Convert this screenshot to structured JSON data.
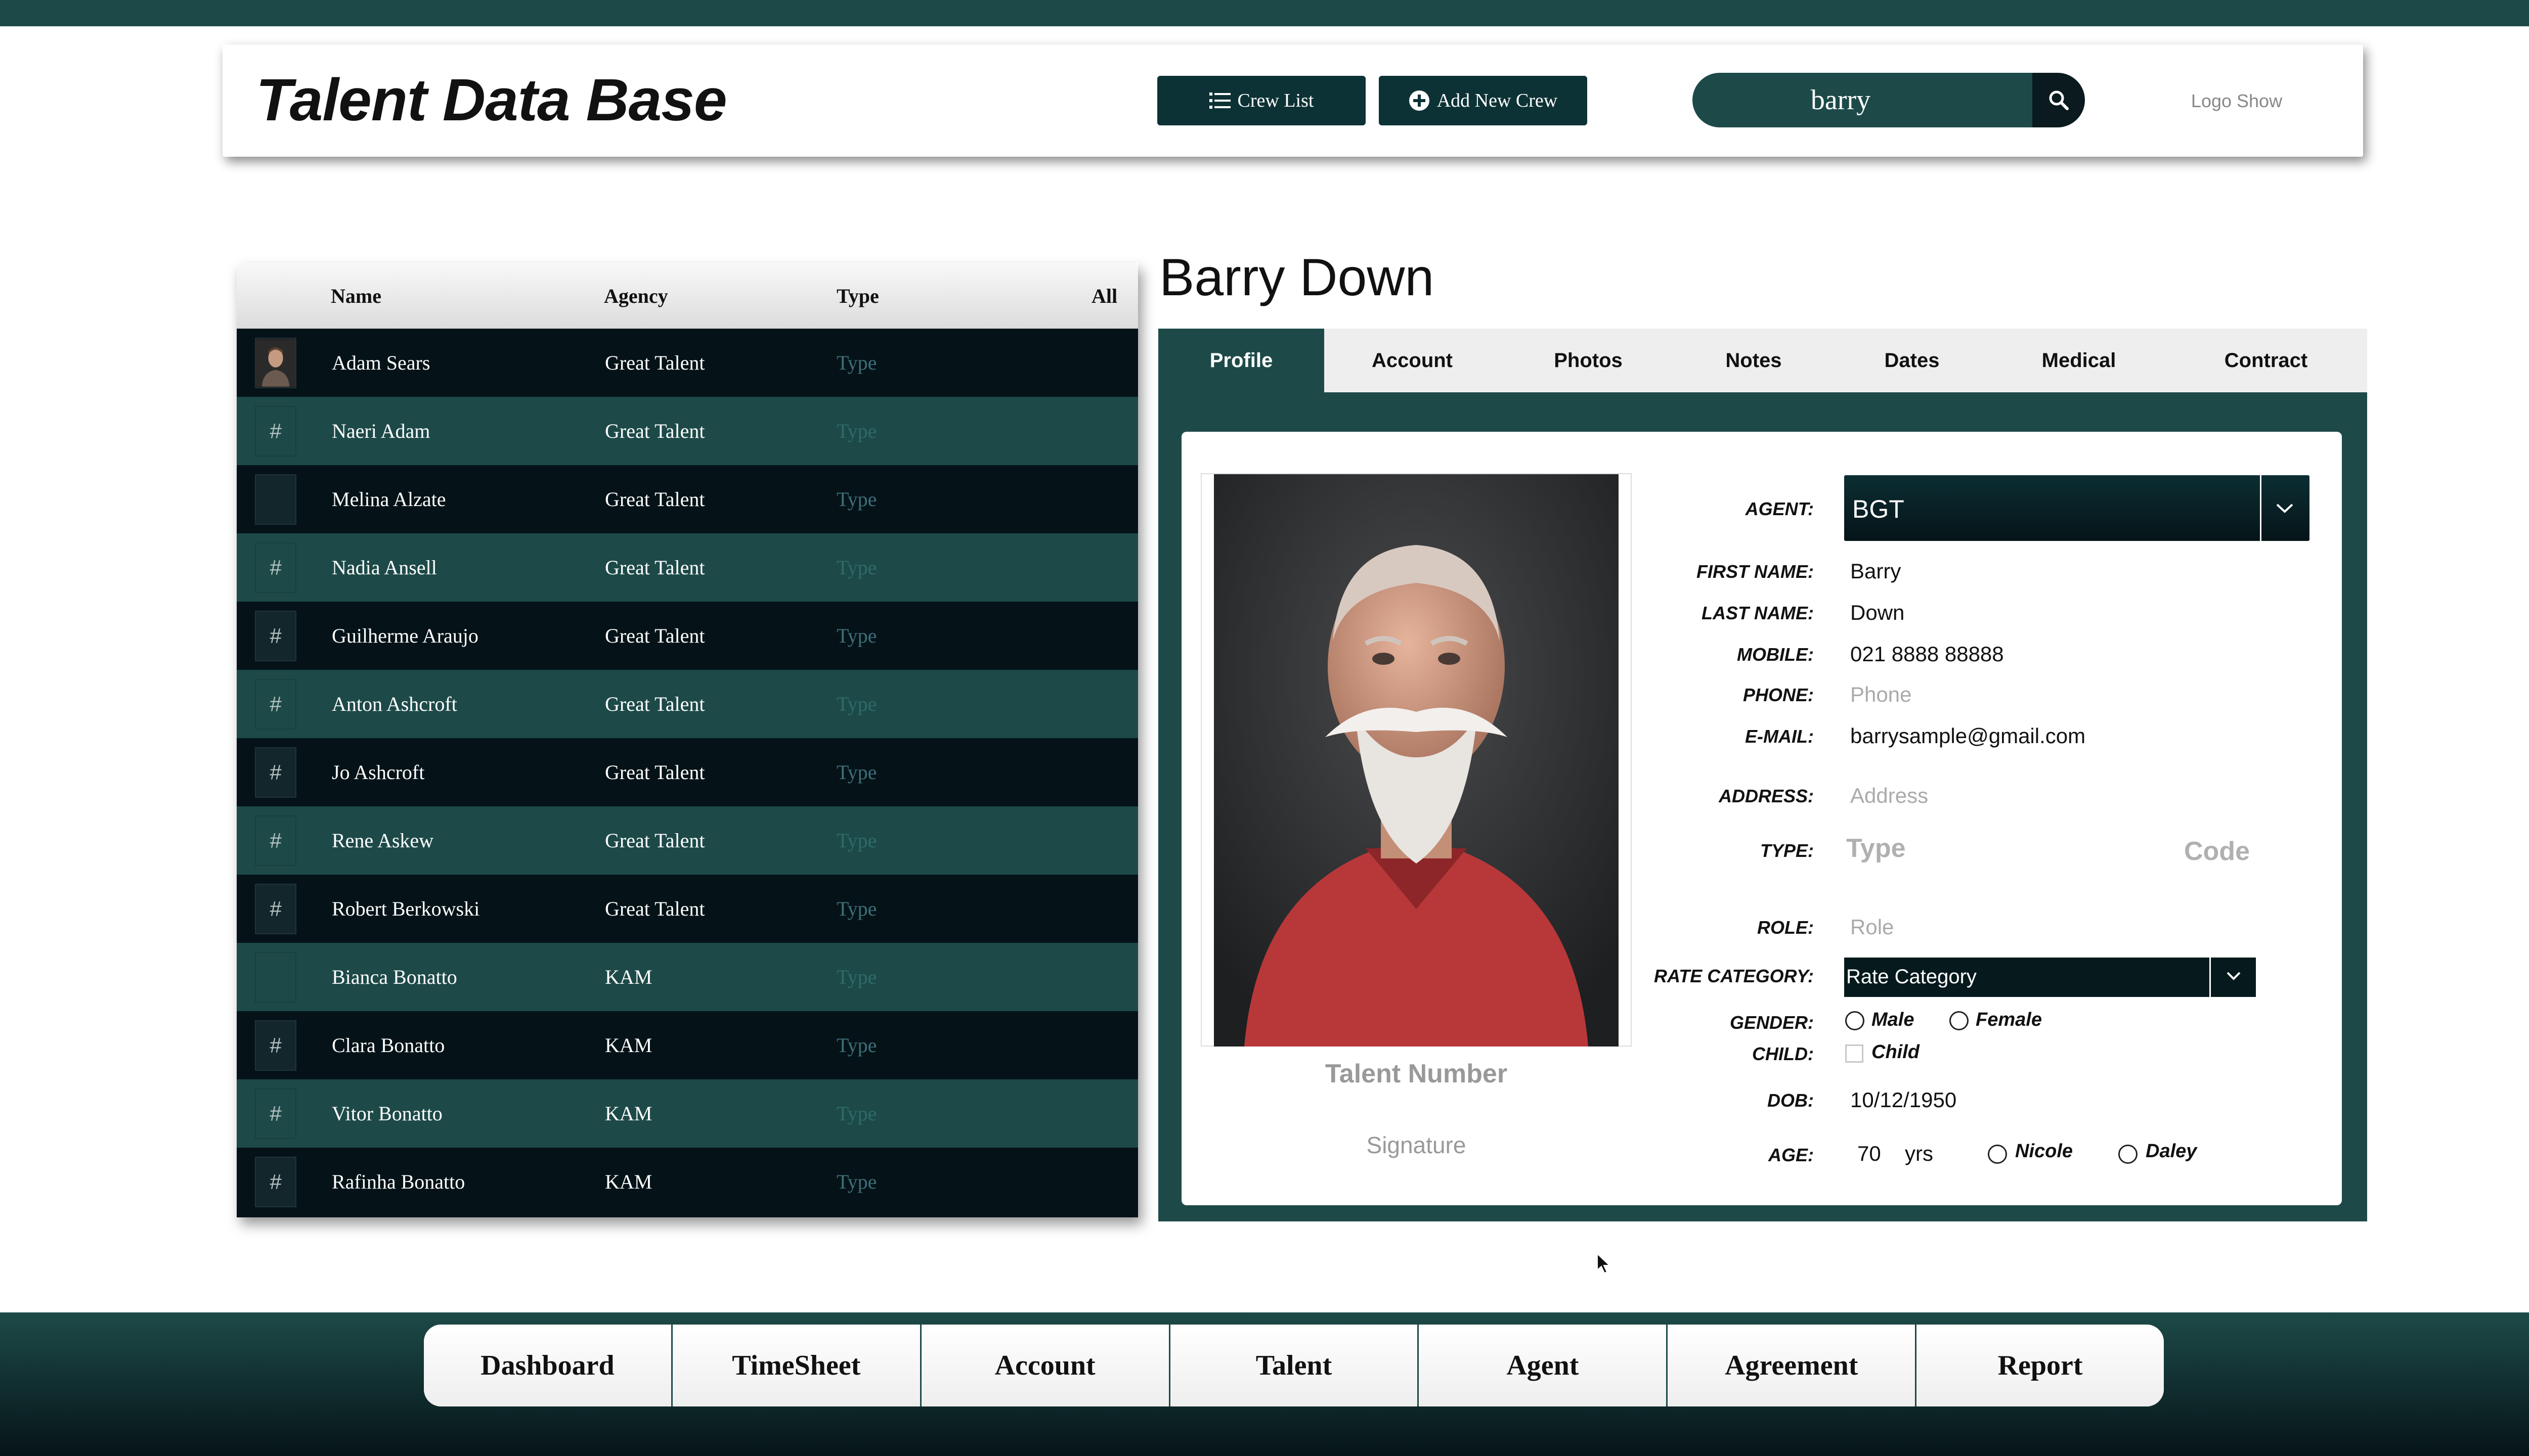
{
  "header": {
    "app_title": "Talent Data Base",
    "crew_list_label": "Crew List",
    "add_crew_label": "Add New Crew",
    "search_value": "barry",
    "logo_text": "Logo Show"
  },
  "list": {
    "columns": {
      "name": "Name",
      "agency": "Agency",
      "type": "Type",
      "filter": "All"
    },
    "rows": [
      {
        "thumb": "",
        "name": "Adam Sears",
        "agency": "Great Talent",
        "type": "Type"
      },
      {
        "thumb": "#",
        "name": "Naeri Adam",
        "agency": "Great Talent",
        "type": "Type"
      },
      {
        "thumb": "",
        "name": "Melina Alzate",
        "agency": "Great Talent",
        "type": "Type"
      },
      {
        "thumb": "#",
        "name": "Nadia Ansell",
        "agency": "Great Talent",
        "type": "Type"
      },
      {
        "thumb": "#",
        "name": "Guilherme Araujo",
        "agency": "Great Talent",
        "type": "Type"
      },
      {
        "thumb": "#",
        "name": "Anton Ashcroft",
        "agency": "Great Talent",
        "type": "Type"
      },
      {
        "thumb": "#",
        "name": "Jo Ashcroft",
        "agency": "Great Talent",
        "type": "Type"
      },
      {
        "thumb": "#",
        "name": "Rene Askew",
        "agency": "Great Talent",
        "type": "Type"
      },
      {
        "thumb": "#",
        "name": "Robert Berkowski",
        "agency": "Great Talent",
        "type": "Type"
      },
      {
        "thumb": "",
        "name": "Bianca Bonatto",
        "agency": "KAM",
        "type": "Type"
      },
      {
        "thumb": "#",
        "name": "Clara Bonatto",
        "agency": "KAM",
        "type": "Type"
      },
      {
        "thumb": "#",
        "name": "Vitor Bonatto",
        "agency": "KAM",
        "type": "Type"
      },
      {
        "thumb": "#",
        "name": "Rafinha Bonatto",
        "agency": "KAM",
        "type": "Type"
      }
    ]
  },
  "profile": {
    "talent_name": "Barry Down",
    "tabs": [
      "Profile",
      "Account",
      "Photos",
      "Notes",
      "Dates",
      "Medical",
      "Contract"
    ],
    "active_tab": "Profile",
    "talent_number_label": "Talent Number",
    "signature_label": "Signature",
    "labels": {
      "agent": "AGENT:",
      "first_name": "FIRST NAME:",
      "last_name": "LAST NAME:",
      "mobile": "MOBILE:",
      "phone": "PHONE:",
      "email": "E-MAIL:",
      "address": "ADDRESS:",
      "type": "TYPE:",
      "role": "ROLE:",
      "rate_category": "RATE CATEGORY:",
      "gender": "GENDER:",
      "child": "CHILD:",
      "dob": "DOB:",
      "age": "AGE:"
    },
    "values": {
      "agent": "BGT",
      "first_name": "Barry",
      "last_name": "Down",
      "mobile": "021 8888 88888",
      "email": "barrysample@gmail.com",
      "dob": "10/12/1950",
      "age": "70",
      "age_unit": "yrs"
    },
    "placeholders": {
      "phone": "Phone",
      "address": "Address",
      "type": "Type",
      "code": "Code",
      "role": "Role",
      "rate_category": "Rate Category"
    },
    "options": {
      "gender_male": "Male",
      "gender_female": "Female",
      "child": "Child",
      "nicole": "Nicole",
      "daley": "Daley"
    }
  },
  "bottom_nav": [
    "Dashboard",
    "TimeSheet",
    "Account",
    "Talent",
    "Agent",
    "Agreement",
    "Report"
  ],
  "colors": {
    "primary_teal": "#1d4a48",
    "dark": "#051318"
  }
}
